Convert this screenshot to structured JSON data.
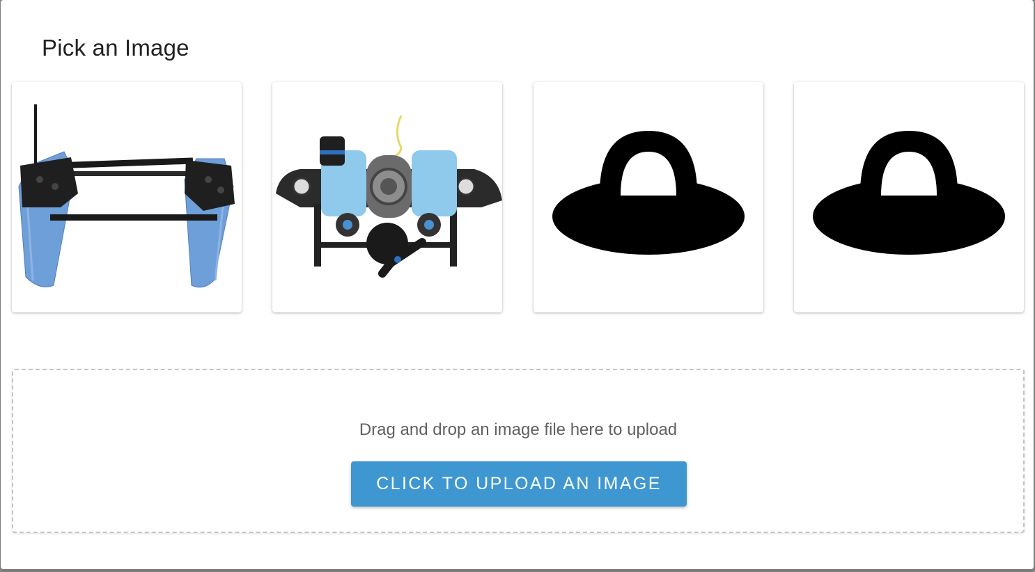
{
  "dialog": {
    "title": "Pick an Image"
  },
  "gallery": {
    "images": [
      {
        "icon": "catamaran-boat-icon"
      },
      {
        "icon": "underwater-rov-icon"
      },
      {
        "icon": "hat-icon"
      },
      {
        "icon": "hat-icon"
      }
    ]
  },
  "upload": {
    "hint": "Drag and drop an image file here to upload",
    "button_label": "CLICK TO UPLOAD AN IMAGE",
    "button_color": "#3e97d1"
  }
}
